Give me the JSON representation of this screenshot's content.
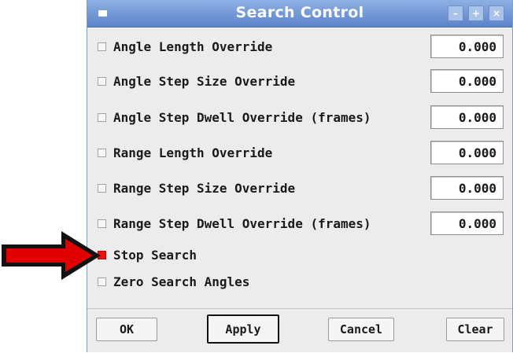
{
  "window": {
    "title": "Search Control",
    "controls": [
      "–",
      "+",
      "×"
    ]
  },
  "options": [
    {
      "label": "Angle Length Override",
      "checked": false,
      "value": "0.000"
    },
    {
      "label": "Angle Step Size Override",
      "checked": false,
      "value": "0.000"
    },
    {
      "label": "Angle Step Dwell Override (frames)",
      "checked": false,
      "value": "0.000"
    },
    {
      "label": "Range Length Override",
      "checked": false,
      "value": "0.000"
    },
    {
      "label": "Range Step Size Override",
      "checked": false,
      "value": "0.000"
    },
    {
      "label": "Range Step Dwell Override (frames)",
      "checked": false,
      "value": "0.000"
    },
    {
      "label": "Stop Search",
      "checked": true
    },
    {
      "label": "Zero Search Angles",
      "checked": false
    }
  ],
  "buttons": {
    "ok": "OK",
    "apply": "Apply",
    "cancel": "Cancel",
    "clear": "Clear"
  },
  "colors": {
    "titlebar": "#6b91d4",
    "annotation_arrow": "#e00000",
    "checked": "#ee1111"
  }
}
